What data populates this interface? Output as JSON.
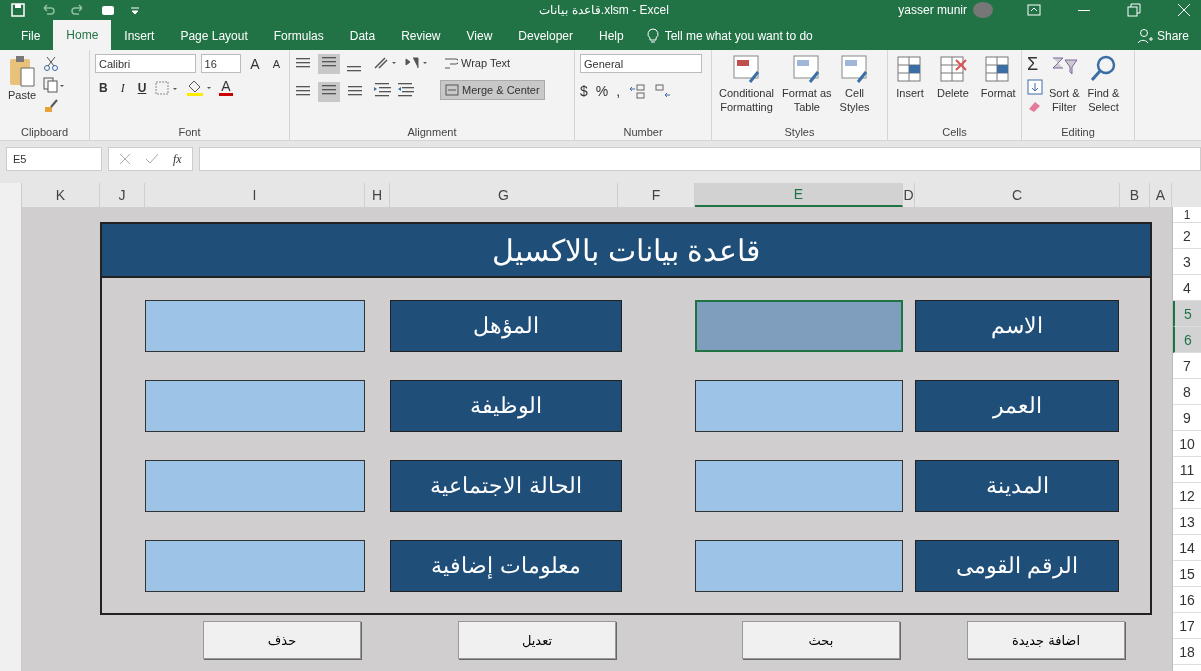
{
  "window": {
    "title": "قاعدة بيانات.xlsm  -  Excel",
    "user": "yasser munir"
  },
  "ribbon_tabs": [
    {
      "label": "File",
      "selected": false
    },
    {
      "label": "Home",
      "selected": true
    },
    {
      "label": "Insert",
      "selected": false
    },
    {
      "label": "Page Layout",
      "selected": false
    },
    {
      "label": "Formulas",
      "selected": false
    },
    {
      "label": "Data",
      "selected": false
    },
    {
      "label": "Review",
      "selected": false
    },
    {
      "label": "View",
      "selected": false
    },
    {
      "label": "Developer",
      "selected": false
    },
    {
      "label": "Help",
      "selected": false
    }
  ],
  "tell_me": "Tell me what you want to do",
  "share": "Share",
  "clipboard": {
    "paste": "Paste",
    "label": "Clipboard"
  },
  "font": {
    "family": "Calibri",
    "size": "16",
    "grow": "A",
    "shrink": "A",
    "styles": [
      "B",
      "I",
      "U"
    ],
    "font_color": "A",
    "label": "Font"
  },
  "alignment": {
    "wrap": "Wrap Text",
    "merge": "Merge & Center",
    "merge_pressed": true,
    "label": "Alignment"
  },
  "number": {
    "format": "General",
    "symbols": [
      "$",
      "%",
      ","
    ],
    "label": "Number"
  },
  "styles": {
    "buttons": [
      [
        "Conditional",
        "Formatting"
      ],
      [
        "Format as",
        "Table"
      ],
      [
        "Cell",
        "Styles"
      ]
    ],
    "label": "Styles"
  },
  "cells": {
    "buttons": [
      "Insert",
      "Delete",
      "Format"
    ],
    "label": "Cells"
  },
  "editing": {
    "sum": "Σ",
    "buttons": [
      [
        "Sort &",
        "Filter"
      ],
      [
        "Find &",
        "Select"
      ]
    ],
    "label": "Editing"
  },
  "name_box": "E5",
  "fx": "fx",
  "columns": [
    {
      "label": "K",
      "selected": false
    },
    {
      "label": "J",
      "selected": false
    },
    {
      "label": "I",
      "selected": false
    },
    {
      "label": "H",
      "selected": false
    },
    {
      "label": "G",
      "selected": false
    },
    {
      "label": "F",
      "selected": false
    },
    {
      "label": "E",
      "selected": true
    },
    {
      "label": "D",
      "selected": false
    },
    {
      "label": "C",
      "selected": false
    },
    {
      "label": "B",
      "selected": false
    },
    {
      "label": "A",
      "selected": false
    }
  ],
  "rows": [
    {
      "label": "1",
      "selected": false
    },
    {
      "label": "2",
      "selected": false
    },
    {
      "label": "3",
      "selected": false
    },
    {
      "label": "4",
      "selected": false
    },
    {
      "label": "5",
      "selected": true
    },
    {
      "label": "6",
      "selected": true
    },
    {
      "label": "7",
      "selected": false
    },
    {
      "label": "8",
      "selected": false
    },
    {
      "label": "9",
      "selected": false
    },
    {
      "label": "10",
      "selected": false
    },
    {
      "label": "11",
      "selected": false
    },
    {
      "label": "12",
      "selected": false
    },
    {
      "label": "13",
      "selected": false
    },
    {
      "label": "14",
      "selected": false
    },
    {
      "label": "15",
      "selected": false
    },
    {
      "label": "16",
      "selected": false
    },
    {
      "label": "17",
      "selected": false
    },
    {
      "label": "18",
      "selected": false
    }
  ],
  "form": {
    "title": "قاعدة بيانات بالاكسيل",
    "right_column": [
      {
        "label": "الاسم",
        "selected": true
      },
      {
        "label": "العمر",
        "selected": false
      },
      {
        "label": "المدينة",
        "selected": false
      },
      {
        "label": "الرقم القومى",
        "selected": false
      }
    ],
    "left_column": [
      {
        "label": "المؤهل",
        "selected": false
      },
      {
        "label": "الوظيفة",
        "selected": false
      },
      {
        "label": "الحالة الاجتماعية",
        "selected": false
      },
      {
        "label": "معلومات إضافية",
        "selected": false
      }
    ],
    "buttons": [
      "اضافة جديدة",
      "بحث",
      "تعديل",
      "حذف"
    ]
  }
}
